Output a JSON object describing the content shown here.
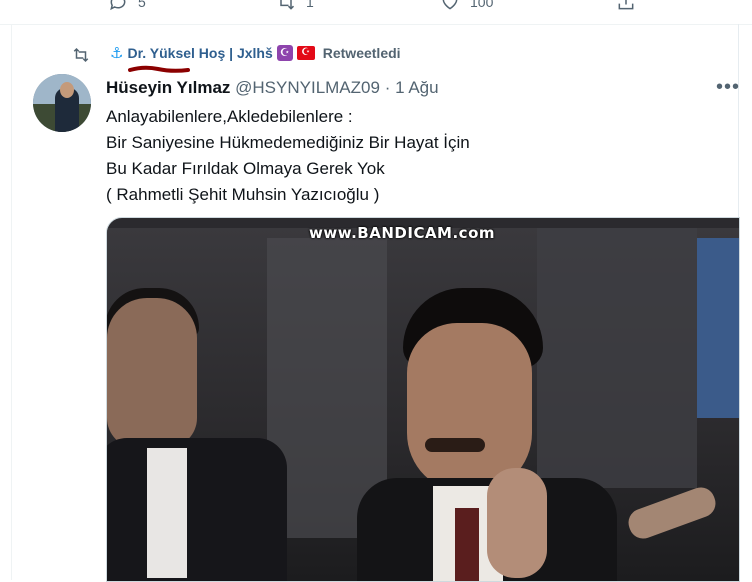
{
  "previous_tweet": {
    "reply_count": "5",
    "retweet_count": "1",
    "like_count": "100"
  },
  "retweet_context": {
    "user_display": "Dr. Yüksel Hoş | Jxlhš",
    "label": "Retweetledi"
  },
  "tweet": {
    "author_name": "Hüseyin Yılmaz",
    "handle": "@HSYNYILMAZ09",
    "separator": "·",
    "date": "1 Ağu",
    "lines": [
      "Anlayabilenlere,Akledebilenlere :",
      "Bir Saniyesine Hükmedemediğiniz Bir Hayat İçin",
      "Bu Kadar Fırıldak Olmaya Gerek Yok",
      "( Rahmetli Şehit Muhsin Yazıcıoğlu )"
    ],
    "more_label": "•••"
  },
  "media": {
    "watermark": "www.BANDICAM.com"
  },
  "icons": {
    "reply": "reply-icon",
    "retweet": "retweet-icon",
    "like": "like-icon",
    "share": "share-icon",
    "anchor": "anchor-icon",
    "moon": "crescent-icon",
    "flag": "turkish-flag-icon",
    "more": "more-icon"
  },
  "colors": {
    "text_primary": "#0f1419",
    "text_secondary": "#536471",
    "accent": "#1d9bf0",
    "scribble": "#8b0000"
  }
}
